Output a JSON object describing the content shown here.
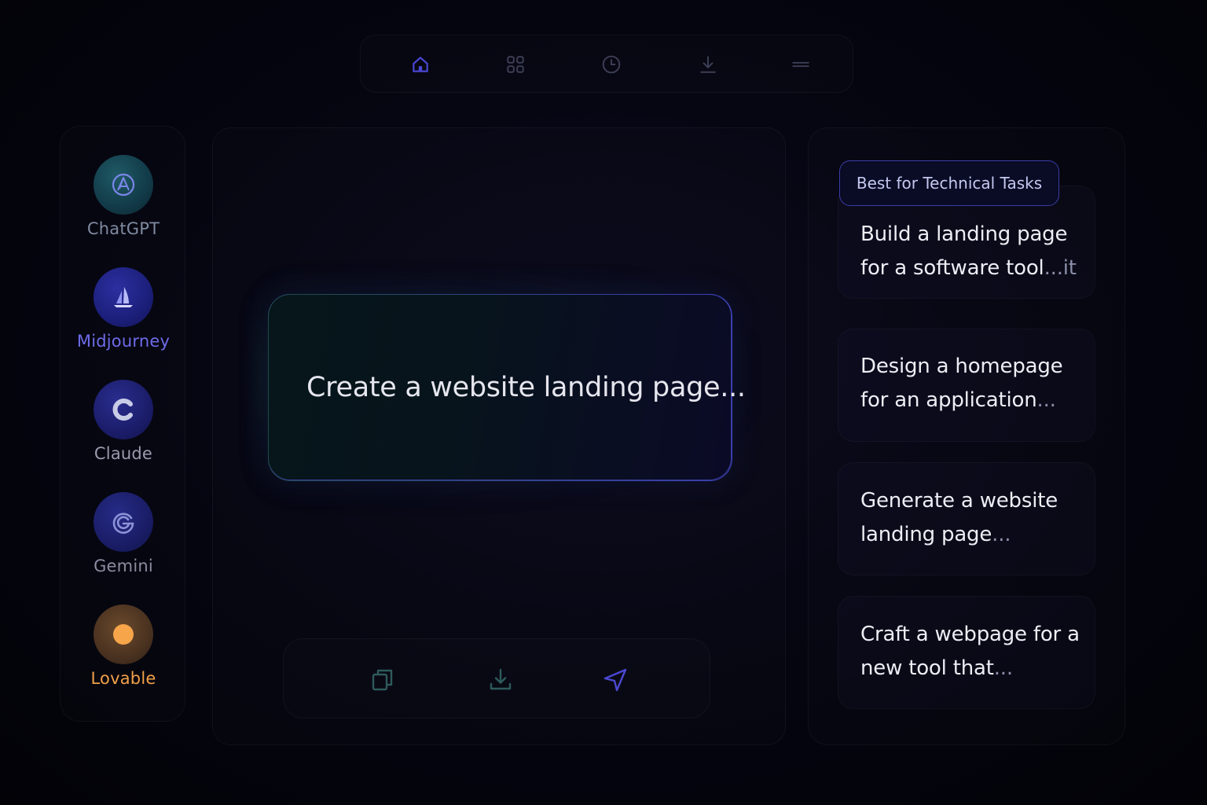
{
  "toolbar": {
    "items": [
      {
        "name": "home",
        "icon": "home-icon",
        "active": true
      },
      {
        "name": "apps",
        "icon": "grid-icon",
        "active": false
      },
      {
        "name": "history",
        "icon": "clock-icon",
        "active": false
      },
      {
        "name": "download",
        "icon": "download-icon",
        "active": false
      },
      {
        "name": "menu",
        "icon": "menu-icon",
        "active": false
      }
    ],
    "active_color": "#4a47d6",
    "inactive_color": "#3c3f56"
  },
  "models": [
    {
      "label": "ChatGPT",
      "icon": "chatgpt-logo-icon",
      "label_color": "#7f8aa0",
      "active": false
    },
    {
      "label": "Midjourney",
      "icon": "sailboat-icon",
      "label_color": "#6d6be8",
      "active": true
    },
    {
      "label": "Claude",
      "icon": "claude-c-icon",
      "label_color": "#9a9cae",
      "active": false
    },
    {
      "label": "Gemini",
      "icon": "gemini-g-icon",
      "label_color": "#8a8ca0",
      "active": false
    },
    {
      "label": "Lovable",
      "icon": "sun-circle-icon",
      "label_color": "#f0a048",
      "active": false
    }
  ],
  "prompt": {
    "text": "Create a website landing page..."
  },
  "actions": [
    {
      "name": "copy",
      "icon": "copy-icon"
    },
    {
      "name": "download",
      "icon": "download-icon"
    },
    {
      "name": "send",
      "icon": "send-icon"
    }
  ],
  "suggestions": {
    "tag": "Best for Technical Tasks",
    "items": [
      {
        "text": "Build a landing page for a software tool",
        "ellipsis": "...it"
      },
      {
        "text": "Design a homepage for an application",
        "ellipsis": "..."
      },
      {
        "text": "Generate a website landing page",
        "ellipsis": "..."
      },
      {
        "text": "Craft a webpage for a new tool that",
        "ellipsis": "..."
      }
    ]
  }
}
